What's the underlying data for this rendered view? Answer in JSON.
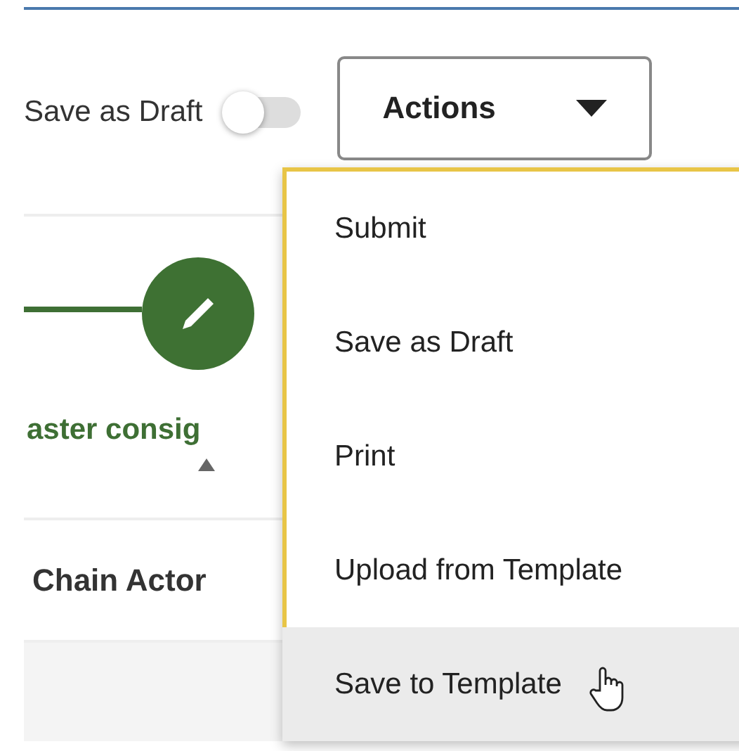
{
  "toolbar": {
    "draft_toggle": {
      "label": "Save as Draft",
      "on": false
    },
    "actions_button": {
      "label": "Actions"
    }
  },
  "stepper": {
    "steps": [
      {
        "label": "aster consig",
        "active": true
      }
    ]
  },
  "table": {
    "header": "Chain Actor"
  },
  "actions_menu": {
    "items": [
      {
        "label": "Submit",
        "hovered": false
      },
      {
        "label": "Save as Draft",
        "hovered": false
      },
      {
        "label": "Print",
        "hovered": false
      },
      {
        "label": "Upload from Template",
        "hovered": false
      },
      {
        "label": "Save to Template",
        "hovered": true
      }
    ]
  }
}
